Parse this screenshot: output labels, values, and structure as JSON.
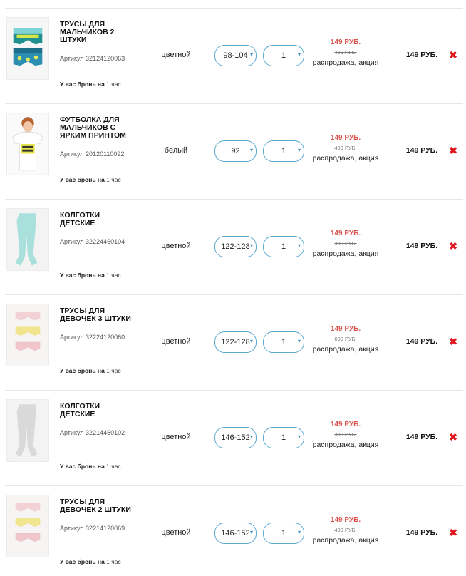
{
  "cart": {
    "reserve_prefix": "У вас бронь на",
    "reserve_num": "1",
    "reserve_unit": "час",
    "items": [
      {
        "title_lines": [
          "ТРУСЫ ДЛЯ",
          "МАЛЬЧИКОВ 2",
          "ШТУКИ"
        ],
        "article": "Артикул 32124120063",
        "color": "цветной",
        "size": "98-104",
        "qty": "1",
        "price": "149 РУБ.",
        "old_price": "499 РУБ.",
        "promo": "распродажа, акция",
        "total": "149 РУБ.",
        "thumb_icon": "boys-briefs-image"
      },
      {
        "title_lines": [
          "ФУТБОЛКА ДЛЯ",
          "МАЛЬЧИКОВ С",
          "ЯРКИМ ПРИНТОМ"
        ],
        "article": "Артикул 20120110092",
        "color": "белый",
        "size": "92",
        "qty": "1",
        "price": "149 РУБ.",
        "old_price": "499 РУБ.",
        "promo": "распродажа, акция",
        "total": "149 РУБ.",
        "thumb_icon": "tshirt-image"
      },
      {
        "title_lines": [
          "КОЛГОТКИ",
          "ДЕТСКИЕ"
        ],
        "article": "Артикул 32224460104",
        "color": "цветной",
        "size": "122-128",
        "qty": "1",
        "price": "149 РУБ.",
        "old_price": "399 РУБ.",
        "promo": "распродажа, акция",
        "total": "149 РУБ.",
        "thumb_icon": "tights-image"
      },
      {
        "title_lines": [
          "ТРУСЫ ДЛЯ",
          "ДЕВОЧЕК 3 ШТУКИ"
        ],
        "article": "Артикул 32224120060",
        "color": "цветной",
        "size": "122-128",
        "qty": "1",
        "price": "149 РУБ.",
        "old_price": "699 РУБ.",
        "promo": "распродажа, акция",
        "total": "149 РУБ.",
        "thumb_icon": "girls-briefs-image"
      },
      {
        "title_lines": [
          "КОЛГОТКИ",
          "ДЕТСКИЕ"
        ],
        "article": "Артикул 32214460102",
        "color": "цветной",
        "size": "146-152",
        "qty": "1",
        "price": "149 РУБ.",
        "old_price": "399 РУБ.",
        "promo": "распродажа, акция",
        "total": "149 РУБ.",
        "thumb_icon": "tights-image"
      },
      {
        "title_lines": [
          "ТРУСЫ ДЛЯ",
          "ДЕВОЧЕК 2 ШТУКИ"
        ],
        "article": "Артикул 32214120069",
        "color": "цветной",
        "size": "146-152",
        "qty": "1",
        "price": "149 РУБ.",
        "old_price": "499 РУБ.",
        "promo": "распродажа, акция",
        "total": "149 РУБ.",
        "thumb_icon": "girls-briefs-image"
      }
    ]
  },
  "icons": {
    "dropdown": "▾",
    "remove": "✖"
  },
  "colors": {
    "accent_blue": "#5aa9cf",
    "sale_red": "#d9534f",
    "remove_red": "#e0161e"
  }
}
